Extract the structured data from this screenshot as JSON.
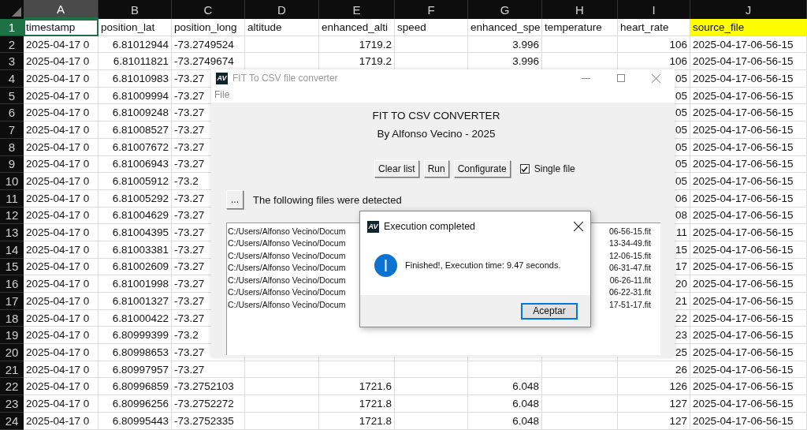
{
  "spreadsheet": {
    "header_row": {
      "number": "1",
      "selected": true
    },
    "columns": [
      {
        "letter": "A",
        "field": "timestamp",
        "kind": "text",
        "selected": true
      },
      {
        "letter": "B",
        "field": "position_lat",
        "kind": "number",
        "selected": false
      },
      {
        "letter": "C",
        "field": "position_long",
        "kind": "text",
        "selected": false
      },
      {
        "letter": "D",
        "field": "altitude",
        "kind": "number",
        "selected": false
      },
      {
        "letter": "E",
        "field": "enhanced_alti",
        "kind": "number",
        "selected": false
      },
      {
        "letter": "F",
        "field": "speed",
        "kind": "number",
        "selected": false
      },
      {
        "letter": "G",
        "field": "enhanced_spe",
        "kind": "number",
        "selected": false
      },
      {
        "letter": "H",
        "field": "temperature",
        "kind": "number",
        "selected": false
      },
      {
        "letter": "I",
        "field": "heart_rate",
        "kind": "number",
        "selected": false
      },
      {
        "letter": "J",
        "field": "source_file",
        "kind": "text",
        "selected": false,
        "highlighted": true
      }
    ],
    "rows": [
      {
        "number": "2",
        "cells": {
          "A": "2025-04-17 0",
          "B": "6.81012944",
          "C": "-73.2749524",
          "E": "1719.2",
          "G": "3.996",
          "I": "106",
          "J": "2025-04-17-06-56-15"
        }
      },
      {
        "number": "3",
        "cells": {
          "A": "2025-04-17 0",
          "B": "6.81011821",
          "C": "-73.2749674",
          "E": "1719.2",
          "G": "3.996",
          "I": "106",
          "J": "2025-04-17-06-56-15"
        }
      },
      {
        "number": "4",
        "cells": {
          "A": "2025-04-17 0",
          "B": "6.81010983",
          "C": "-73.27",
          "I": "05",
          "J": "2025-04-17-06-56-15"
        }
      },
      {
        "number": "5",
        "cells": {
          "A": "2025-04-17 0",
          "B": "6.81009994",
          "C": "-73.27",
          "I": "05",
          "J": "2025-04-17-06-56-15"
        }
      },
      {
        "number": "6",
        "cells": {
          "A": "2025-04-17 0",
          "B": "6.81009248",
          "C": "-73.27",
          "I": "05",
          "J": "2025-04-17-06-56-15"
        }
      },
      {
        "number": "7",
        "cells": {
          "A": "2025-04-17 0",
          "B": "6.81008527",
          "C": "-73.27",
          "I": "05",
          "J": "2025-04-17-06-56-15"
        }
      },
      {
        "number": "8",
        "cells": {
          "A": "2025-04-17 0",
          "B": "6.81007672",
          "C": "-73.27",
          "I": "05",
          "J": "2025-04-17-06-56-15"
        }
      },
      {
        "number": "9",
        "cells": {
          "A": "2025-04-17 0",
          "B": "6.81006943",
          "C": "-73.27",
          "I": "05",
          "J": "2025-04-17-06-56-15"
        }
      },
      {
        "number": "10",
        "cells": {
          "A": "2025-04-17 0",
          "B": "6.81005912",
          "C": "-73.2",
          "I": "05",
          "J": "2025-04-17-06-56-15"
        }
      },
      {
        "number": "11",
        "cells": {
          "A": "2025-04-17 0",
          "B": "6.81005292",
          "C": "-73.27",
          "I": "06",
          "J": "2025-04-17-06-56-15"
        }
      },
      {
        "number": "12",
        "cells": {
          "A": "2025-04-17 0",
          "B": "6.81004629",
          "C": "-73.27",
          "I": "08",
          "J": "2025-04-17-06-56-15"
        }
      },
      {
        "number": "13",
        "cells": {
          "A": "2025-04-17 0",
          "B": "6.81004395",
          "C": "-73.27",
          "I": "11",
          "J": "2025-04-17-06-56-15"
        }
      },
      {
        "number": "14",
        "cells": {
          "A": "2025-04-17 0",
          "B": "6.81003381",
          "C": "-73.27",
          "I": "15",
          "J": "2025-04-17-06-56-15"
        }
      },
      {
        "number": "15",
        "cells": {
          "A": "2025-04-17 0",
          "B": "6.81002609",
          "C": "-73.27",
          "I": "17",
          "J": "2025-04-17-06-56-15"
        }
      },
      {
        "number": "16",
        "cells": {
          "A": "2025-04-17 0",
          "B": "6.81001998",
          "C": "-73.27",
          "I": "20",
          "J": "2025-04-17-06-56-15"
        }
      },
      {
        "number": "17",
        "cells": {
          "A": "2025-04-17 0",
          "B": "6.81001327",
          "C": "-73.27",
          "I": "21",
          "J": "2025-04-17-06-56-15"
        }
      },
      {
        "number": "18",
        "cells": {
          "A": "2025-04-17 0",
          "B": "6.81000422",
          "C": "-73.27",
          "I": "22",
          "J": "2025-04-17-06-56-15"
        }
      },
      {
        "number": "19",
        "cells": {
          "A": "2025-04-17 0",
          "B": "6.80999399",
          "C": "-73.2",
          "I": "23",
          "J": "2025-04-17-06-56-15"
        }
      },
      {
        "number": "20",
        "cells": {
          "A": "2025-04-17 0",
          "B": "6.80998653",
          "C": "-73.27",
          "I": "25",
          "J": "2025-04-17-06-56-15"
        }
      },
      {
        "number": "21",
        "cells": {
          "A": "2025-04-17 0",
          "B": "6.80997957",
          "C": "-73.27",
          "I": "26",
          "J": "2025-04-17-06-56-15"
        }
      },
      {
        "number": "22",
        "cells": {
          "A": "2025-04-17 0",
          "B": "6.80996859",
          "C": "-73.2752103",
          "E": "1721.6",
          "G": "6.048",
          "I": "126",
          "J": "2025-04-17-06-56-15"
        }
      },
      {
        "number": "23",
        "cells": {
          "A": "2025-04-17 0",
          "B": "6.80996256",
          "C": "-73.2752272",
          "E": "1721.8",
          "G": "6.048",
          "I": "127",
          "J": "2025-04-17-06-56-15"
        }
      },
      {
        "number": "24",
        "cells": {
          "A": "2025-04-17 0",
          "B": "6.80995443",
          "C": "-73.2752335",
          "E": "1721.8",
          "G": "6.048",
          "I": "127",
          "J": "2025-04-17-06-56-15"
        }
      }
    ]
  },
  "window": {
    "app_icon": "AV",
    "title": "FIT To CSV file converter",
    "menu": [
      "File"
    ],
    "heading": "FIT TO CSV CONVERTER",
    "author": "By Alfonso Vecino - 2025",
    "buttons": [
      "Clear list",
      "Run",
      "Configurate"
    ],
    "single_file": {
      "label": "Single file",
      "checked": true
    },
    "browse_button": "...",
    "files_label": "The following files were detected",
    "files": [
      {
        "start": "C:/Users/Alfonso Vecino/Docum",
        "end": "06-56-15.fit"
      },
      {
        "start": "C:/Users/Alfonso Vecino/Docum",
        "end": "13-34-49.fit"
      },
      {
        "start": "C:/Users/Alfonso Vecino/Docum",
        "end": "12-06-15.fit"
      },
      {
        "start": "C:/Users/Alfonso Vecino/Docum",
        "end": "06-31-47.fit"
      },
      {
        "start": "C:/Users/Alfonso Vecino/Docum",
        "end": "06-26-11.fit"
      },
      {
        "start": "C:/Users/Alfonso Vecino/Docum",
        "end": "06-22-31.fit"
      },
      {
        "start": "C:/Users/Alfonso Vecino/Docum",
        "end": "17-51-17.fit"
      }
    ]
  },
  "dialog": {
    "app_icon": "AV",
    "title": "Execution completed",
    "kind": "info",
    "message": "Finished!, Execution time: 9.47 seconds.",
    "button": "Aceptar"
  }
}
